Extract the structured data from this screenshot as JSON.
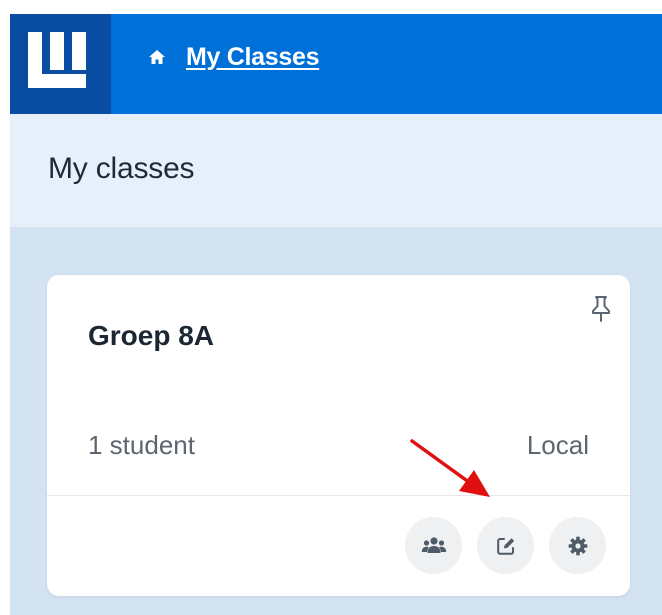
{
  "header": {
    "breadcrumb": {
      "label": "My Classes",
      "icon": "home-icon"
    },
    "logo_icon": "app-logo"
  },
  "page": {
    "title": "My classes"
  },
  "class_card": {
    "name": "Groep 8A",
    "student_count": "1 student",
    "type": "Local",
    "pin_icon": "pin-icon",
    "actions": [
      {
        "name": "students-button",
        "icon": "people-icon"
      },
      {
        "name": "edit-button",
        "icon": "edit-icon"
      },
      {
        "name": "settings-button",
        "icon": "gear-icon"
      }
    ]
  },
  "colors": {
    "header_bg": "#0070d9",
    "logo_bg": "#084da1",
    "heading_band": "#e7f0fa",
    "content_bg": "#d3e3f2",
    "card_bg": "#ffffff",
    "action_btn_bg": "#eef0f2",
    "annotation_arrow": "#e01010"
  }
}
